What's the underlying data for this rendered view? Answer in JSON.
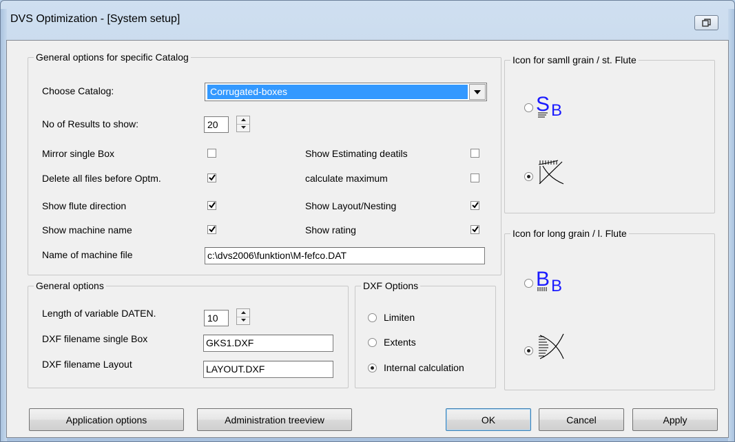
{
  "window": {
    "title": "DVS Optimization - [System setup]"
  },
  "catalog_group": {
    "title": "General options for specific Catalog",
    "choose_catalog_label": "Choose Catalog:",
    "catalog_selected": "Corrugated-boxes",
    "results_label": "No of Results to show:",
    "results_value": "20",
    "options": [
      {
        "label": "Mirror single Box",
        "checked": false
      },
      {
        "label": "Delete all files before Optm.",
        "checked": true
      },
      {
        "label": "Show flute direction",
        "checked": true
      },
      {
        "label": "Show machine name",
        "checked": true
      },
      {
        "label": "Show Estimating deatils",
        "checked": false
      },
      {
        "label": "calculate maximum",
        "checked": false
      },
      {
        "label": "Show Layout/Nesting",
        "checked": true
      },
      {
        "label": "Show rating",
        "checked": true
      }
    ],
    "machine_file_label": "Name of machine file",
    "machine_file_value": "c:\\dvs2006\\funktion\\M-fefco.DAT"
  },
  "general_group": {
    "title": "General options",
    "daten_label": "Length of variable DATEN.",
    "daten_value": "10",
    "dxf_single_label": "DXF filename single Box",
    "dxf_single_value": "GKS1.DXF",
    "dxf_layout_label": "DXF filename Layout",
    "dxf_layout_value": "LAYOUT.DXF"
  },
  "dxf_group": {
    "title": "DXF Options",
    "options": [
      {
        "label": "Limiten",
        "selected": false
      },
      {
        "label": "Extents",
        "selected": false
      },
      {
        "label": "Internal calculation",
        "selected": true
      }
    ]
  },
  "small_grain_group": {
    "title": "Icon for samll grain / st. Flute",
    "icons": [
      {
        "icon": "sb-small-grain-icon",
        "selected": false
      },
      {
        "icon": "flute-lines-icon",
        "selected": true
      }
    ]
  },
  "long_grain_group": {
    "title": "Icon for long grain / l. Flute",
    "icons": [
      {
        "icon": "bb-long-grain-icon",
        "selected": false
      },
      {
        "icon": "flute-lines-long-icon",
        "selected": true
      }
    ]
  },
  "buttons": {
    "app_options": "Application options",
    "admin_treeview": "Administration treeview",
    "ok": "OK",
    "cancel": "Cancel",
    "apply": "Apply"
  },
  "colors": {
    "selection": "#3399ff",
    "icon_blue": "#1a1aff",
    "title_bar": "#b9d1ea"
  }
}
